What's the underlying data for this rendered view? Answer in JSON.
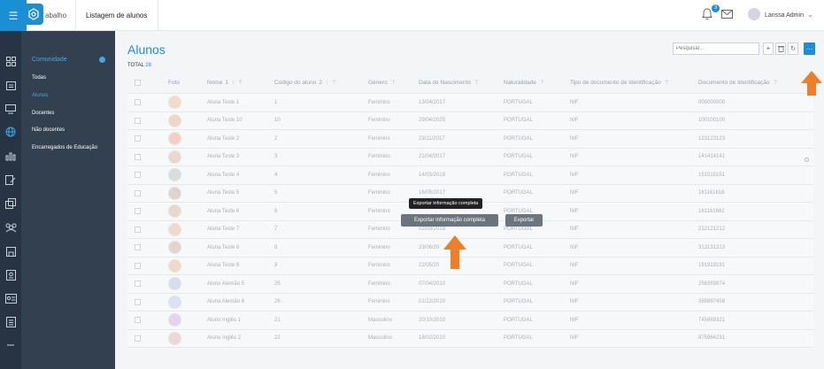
{
  "topbar": {
    "tab1_label": "abalho",
    "tab2_label": "Listagem de alunos",
    "notif_count": "3",
    "user_name": "Larissa Admin"
  },
  "rail": {
    "icons": [
      "grid-icon",
      "calendar-icon",
      "monitor-icon",
      "globe-icon",
      "chart-icon",
      "document-icon",
      "copy-icon",
      "people-icon",
      "save-icon",
      "id-card-icon",
      "id-badge-icon",
      "list-icon"
    ]
  },
  "subnav": {
    "title": "Comunidade",
    "items": [
      "Todas",
      "Alunos",
      "Docentes",
      "Não docentes",
      "Encarregados de Educação"
    ],
    "active_index": 1
  },
  "main": {
    "title": "Alunos",
    "total_label": "TOTAL",
    "total_value": "28",
    "search_placeholder": "Pesquisar..."
  },
  "table": {
    "headers": {
      "foto": "Foto",
      "nome": "Nome",
      "nome_sort": "1",
      "codigo": "Código do aluno",
      "codigo_sort": "2",
      "genero": "Género",
      "nascimento": "Data de Nascimento",
      "naturalidade": "Naturalidade",
      "tipo_doc": "Tipo de documento de Identificação",
      "doc": "Documento de Identificação"
    },
    "rows": [
      {
        "nome": "Aluna Teste 1",
        "codigo": "1",
        "genero": "Feminino",
        "nascimento": "13/04/2017",
        "naturalidade": "PORTUGAL",
        "tipo": "NIF",
        "doc": "000000000"
      },
      {
        "nome": "Aluna Teste 10",
        "codigo": "10",
        "genero": "Feminino",
        "nascimento": "29/04/2025",
        "naturalidade": "PORTUGAL",
        "tipo": "NIF",
        "doc": "100100100"
      },
      {
        "nome": "Aluna Teste 2",
        "codigo": "2",
        "genero": "Feminino",
        "nascimento": "23/11/2017",
        "naturalidade": "PORTUGAL",
        "tipo": "NIF",
        "doc": "123123123"
      },
      {
        "nome": "Aluna Teste 3",
        "codigo": "3",
        "genero": "Feminino",
        "nascimento": "21/04/2017",
        "naturalidade": "PORTUGAL",
        "tipo": "NIF",
        "doc": "141414141"
      },
      {
        "nome": "Aluna Teste 4",
        "codigo": "4",
        "genero": "Feminino",
        "nascimento": "14/03/2018",
        "naturalidade": "PORTUGAL",
        "tipo": "NIF",
        "doc": "151515151"
      },
      {
        "nome": "Aluna Teste 5",
        "codigo": "5",
        "genero": "Feminino",
        "nascimento": "16/05/2017",
        "naturalidade": "PORTUGAL",
        "tipo": "NIF",
        "doc": "161161616"
      },
      {
        "nome": "Aluna Teste 6",
        "codigo": "6",
        "genero": "Feminino",
        "nascimento": "",
        "naturalidade": "PORTUGAL",
        "tipo": "NIF",
        "doc": "161161661"
      },
      {
        "nome": "Aluna Teste 7",
        "codigo": "7",
        "genero": "Feminino",
        "nascimento": "02/03/2018",
        "naturalidade": "PORTUGAL",
        "tipo": "NIF",
        "doc": "212121212"
      },
      {
        "nome": "Aluna Teste 8",
        "codigo": "8",
        "genero": "Feminino",
        "nascimento": "23/06/20",
        "naturalidade": "PORTUGAL",
        "tipo": "NIF",
        "doc": "313131313"
      },
      {
        "nome": "Aluna Teste 9",
        "codigo": "9",
        "genero": "Feminino",
        "nascimento": "22/05/20",
        "naturalidade": "PORTUGAL",
        "tipo": "NIF",
        "doc": "191919191"
      },
      {
        "nome": "Aluno Alemão 5",
        "codigo": "25",
        "genero": "Feminino",
        "nascimento": "07/04/2010",
        "naturalidade": "PORTUGAL",
        "tipo": "NIF",
        "doc": "256359874"
      },
      {
        "nome": "Aluno Alemão 6",
        "codigo": "26",
        "genero": "Feminino",
        "nascimento": "01/12/2010",
        "naturalidade": "PORTUGAL",
        "tipo": "NIF",
        "doc": "365897458"
      },
      {
        "nome": "Aluno Inglês 1",
        "codigo": "21",
        "genero": "Masculino",
        "nascimento": "20/10/2010",
        "naturalidade": "PORTUGAL",
        "tipo": "NIF",
        "doc": "745869321"
      },
      {
        "nome": "Aluno Inglês 2",
        "codigo": "22",
        "genero": "Masculino",
        "nascimento": "18/02/2010",
        "naturalidade": "PORTUGAL",
        "tipo": "NIF",
        "doc": "875964231"
      }
    ]
  },
  "menu": {
    "tooltip": "Exportar informação completa",
    "export_full_label": "Exportar informação completa",
    "export_label": "Exportar"
  },
  "colors": {
    "accent": "#1a8fd4",
    "arrow": "#f07d28",
    "rail_bg": "#283444",
    "subnav_bg": "#33404f"
  }
}
